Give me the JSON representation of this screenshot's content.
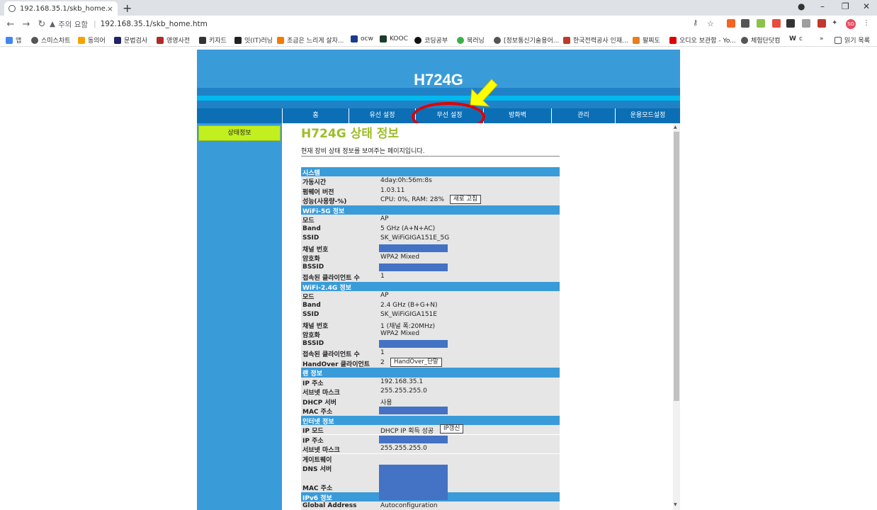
{
  "browser": {
    "tab_title": "192.168.35.1/skb_home.htm",
    "tab_close": "×",
    "new_tab": "+",
    "security_label": "주의 요함",
    "url": "192.168.35.1/skb_home.htm",
    "profile_initials": "SG",
    "bookmarks": [
      {
        "label": "앱",
        "color": "#4285f4"
      },
      {
        "label": "스미스차트",
        "color": "#555555"
      },
      {
        "label": "동의어",
        "color": "#f4a300"
      },
      {
        "label": "문법검사",
        "color": "#222266"
      },
      {
        "label": "영영사전",
        "color": "#b02a2a"
      },
      {
        "label": "키자드",
        "color": "#333333"
      },
      {
        "label": "잇(IT)러닝",
        "color": "#222222"
      },
      {
        "label": "조금은 느리게 살자...",
        "color": "#f47b00"
      },
      {
        "label": "ocw",
        "color": "#1a3c8c"
      },
      {
        "label": "KOOC",
        "color": "#1c3d2c"
      },
      {
        "label": "코딩공부",
        "color": "#111111"
      },
      {
        "label": "북러닝",
        "color": "#3fae49"
      },
      {
        "label": "[정보통신기술용어...",
        "color": "#555555"
      },
      {
        "label": "한국전력공사 인재...",
        "color": "#c0392b"
      },
      {
        "label": "팔찌도",
        "color": "#e67e22"
      },
      {
        "label": "오디오 보관함 - Yo...",
        "color": "#e00000"
      },
      {
        "label": "체험단닷컴",
        "color": "#555555"
      },
      {
        "label": "c",
        "color": "#222222"
      }
    ],
    "reading_list": "읽기 목록",
    "more_bookmarks": "»"
  },
  "page": {
    "device_title": "H724G",
    "nav": [
      "홈",
      "유선 설정",
      "무선 설정",
      "방화벽",
      "관리",
      "운용모드설정"
    ],
    "sidebar_item": "상태정보",
    "content_title": "H724G 상태 정보",
    "content_desc": "현재 장비 상태 정보를 보여주는 페이지입니다.",
    "sections": [
      {
        "title": "시스템",
        "rows": [
          {
            "key": "가동시간",
            "value": "4day:0h:56m:8s"
          },
          {
            "key": "펌웨어 버전",
            "value": "1.03.11"
          },
          {
            "key": "성능(사용량-%)",
            "value": "CPU: 0%, RAM: 28%",
            "button": "새로 고침"
          }
        ]
      },
      {
        "title": "WiFi-5G 정보",
        "rows": [
          {
            "key": "모드",
            "value": "AP"
          },
          {
            "key": "Band",
            "value": "5 GHz (A+N+AC)"
          },
          {
            "key": "SSID",
            "value": "SK_WiFiGIGA151E_5G"
          },
          {
            "key": "채널 번호",
            "masked": true
          },
          {
            "key": "암호화",
            "value": "WPA2 Mixed"
          },
          {
            "key": "BSSID",
            "masked": true
          },
          {
            "key": "접속된 클라이언트 수",
            "value": "1"
          }
        ]
      },
      {
        "title": "WiFi-2.4G 정보",
        "rows": [
          {
            "key": "모드",
            "value": "AP"
          },
          {
            "key": "Band",
            "value": "2.4 GHz (B+G+N)"
          },
          {
            "key": "SSID",
            "value": "SK_WiFiGIGA151E"
          },
          {
            "key": "채널 번호",
            "value": "1 (채널 폭:20MHz)"
          },
          {
            "key": "암호화",
            "value": "WPA2 Mixed"
          },
          {
            "key": "BSSID",
            "masked": true
          },
          {
            "key": "접속된 클라이언트 수",
            "value": "1"
          },
          {
            "key": "HandOver 클라이언트",
            "value": "2",
            "button": "HandOver_단말"
          }
        ]
      },
      {
        "title": "랜 정보",
        "rows": [
          {
            "key": "IP 주소",
            "value": "192.168.35.1"
          },
          {
            "key": "서브넷 마스크",
            "value": "255.255.255.0"
          },
          {
            "key": "DHCP 서버",
            "value": "사용"
          },
          {
            "key": "MAC 주소",
            "masked": true
          }
        ]
      },
      {
        "title": "인터넷 정보",
        "rows": [
          {
            "key": "IP 모드",
            "value": "DHCP IP 획득 성공",
            "button": "IP갱신"
          },
          {
            "key": "IP 주소",
            "masked": true
          },
          {
            "key": "서브넷 마스크",
            "value": "255.255.255.0"
          },
          {
            "key": "게이트웨이",
            "value": ""
          },
          {
            "key": "DNS 서버",
            "masked_tall": true
          },
          {
            "key": "MAC 주소",
            "value": ""
          }
        ]
      },
      {
        "title": "IPv6 정보",
        "rows": [
          {
            "key": "Global Address",
            "value": "Autoconfiguration"
          }
        ]
      }
    ]
  }
}
